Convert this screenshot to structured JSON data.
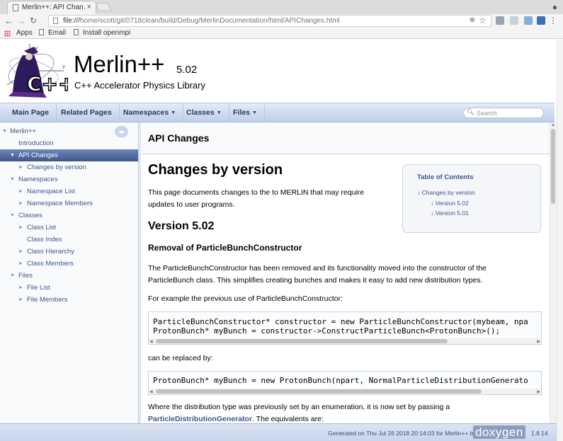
{
  "browser": {
    "tab_title": "Merlin++: API Chan…",
    "tab_close": "×",
    "url_prefix": "file:///",
    "url_path": "home/scott/git/0718clean/build/Debug/MerlinDocumentation/html/APIChanges.html",
    "bookmarks": [
      "Apps",
      "Email",
      "Install openmpi"
    ]
  },
  "header": {
    "project_name": "Merlin++",
    "project_number": "5.02",
    "project_brief": "C++ Accelerator Physics Library"
  },
  "navbar": {
    "items": [
      {
        "label": "Main Page",
        "dropdown": false
      },
      {
        "label": "Related Pages",
        "dropdown": false
      },
      {
        "label": "Namespaces",
        "dropdown": true
      },
      {
        "label": "Classes",
        "dropdown": true
      },
      {
        "label": "Files",
        "dropdown": true
      }
    ],
    "search_placeholder": "Search"
  },
  "tree": [
    {
      "label": "Merlin++",
      "level": 0,
      "expander": "▼",
      "selected": false
    },
    {
      "label": "Introduction",
      "level": 1,
      "expander": "",
      "selected": false
    },
    {
      "label": "API Changes",
      "level": 1,
      "expander": "▼",
      "selected": true
    },
    {
      "label": "Changes by version",
      "level": 2,
      "expander": "►",
      "selected": false
    },
    {
      "label": "Namespaces",
      "level": 1,
      "expander": "▼",
      "selected": false
    },
    {
      "label": "Namespace List",
      "level": 2,
      "expander": "►",
      "selected": false
    },
    {
      "label": "Namespace Members",
      "level": 2,
      "expander": "►",
      "selected": false
    },
    {
      "label": "Classes",
      "level": 1,
      "expander": "▼",
      "selected": false
    },
    {
      "label": "Class List",
      "level": 2,
      "expander": "►",
      "selected": false
    },
    {
      "label": "Class Index",
      "level": 2,
      "expander": "",
      "selected": false
    },
    {
      "label": "Class Hierarchy",
      "level": 2,
      "expander": "►",
      "selected": false
    },
    {
      "label": "Class Members",
      "level": 2,
      "expander": "►",
      "selected": false
    },
    {
      "label": "Files",
      "level": 1,
      "expander": "▼",
      "selected": false
    },
    {
      "label": "File List",
      "level": 2,
      "expander": "►",
      "selected": false
    },
    {
      "label": "File Members",
      "level": 2,
      "expander": "►",
      "selected": false
    }
  ],
  "content": {
    "page_title": "API Changes",
    "h1": "Changes by version",
    "intro": "This page documents changes to the to MERLIN that may require updates to user programs.",
    "h2": "Version 5.02",
    "h3": "Removal of ParticleBunchConstructor",
    "p1": "The ParticleBunchConstructor has been removed and its functionality moved into the constructor of the ParticleBunch class. This simplifies creating bunches and makes it easy to add new distribution types.",
    "p2": "For example the previous use of ParticleBunchConstructor:",
    "code1": [
      "ParticleBunchConstructor* constructor = new ParticleBunchConstructor(mybeam, npa",
      "ProtonBunch* myBunch = constructor->ConstructParticleBunch<ProtonBunch>();"
    ],
    "p3": "can be replaced by:",
    "code2": [
      "ProtonBunch* myBunch = new ProtonBunch(npart, NormalParticleDistributionGenerato"
    ],
    "p4": "Where the distribution type was previously set by an enumeration, it is now set by passing a",
    "p5_link": "ParticleDistributionGenerator",
    "p5_rest": ". The equivalents are:"
  },
  "toc": {
    "title": "Table of Contents",
    "items": [
      "Changes by version",
      "Version 5.02",
      "Version 5.01"
    ]
  },
  "footer": {
    "generated": "Generated on Thu Jul 26 2018 20:14:03 for Merlin++ by",
    "logo": "doxygen",
    "version": "1.8.14"
  }
}
